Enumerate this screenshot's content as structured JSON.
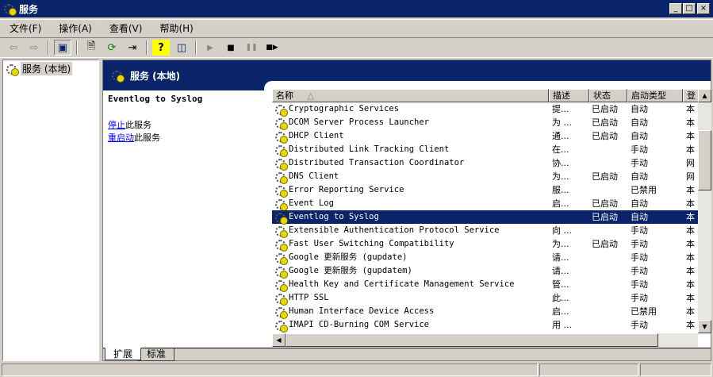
{
  "window": {
    "title": "服务",
    "min": "_",
    "max": "□",
    "close": "×"
  },
  "menu": [
    "文件(F)",
    "操作(A)",
    "查看(V)",
    "帮助(H)"
  ],
  "toolbar": {
    "icons": [
      "back-arrow-icon",
      "forward-arrow-icon",
      "show-hide-tree-icon",
      "properties-icon",
      "refresh-icon",
      "export-list-icon",
      "help-icon",
      "show-hide-action-pane-icon",
      "start-service-icon",
      "stop-service-icon",
      "pause-service-icon",
      "restart-service-icon"
    ],
    "glyphs": [
      "⇦",
      "⇨",
      "▣",
      "🗎",
      "⟳",
      "⇥",
      "?",
      "◫",
      "▶",
      "■",
      "❚❚",
      "■▶"
    ]
  },
  "tree": {
    "item": "服务 (本地)"
  },
  "header": {
    "title": "服务 (本地)"
  },
  "desc": {
    "service_name": "Eventlog to Syslog",
    "stop_link": "停止",
    "stop_suffix": "此服务",
    "restart_link": "重启动",
    "restart_suffix": "此服务"
  },
  "columns": {
    "name": "名称",
    "name_sort": "△",
    "desc": "描述",
    "status": "状态",
    "start": "启动类型",
    "logon": "登"
  },
  "rows": [
    {
      "name": "Cryptographic Services",
      "desc": "提...",
      "status": "已启动",
      "start": "自动",
      "logon": "本"
    },
    {
      "name": "DCOM Server Process Launcher",
      "desc": "为 ...",
      "status": "已启动",
      "start": "自动",
      "logon": "本"
    },
    {
      "name": "DHCP Client",
      "desc": "通...",
      "status": "已启动",
      "start": "自动",
      "logon": "本"
    },
    {
      "name": "Distributed Link Tracking Client",
      "desc": "在...",
      "status": "",
      "start": "手动",
      "logon": "本"
    },
    {
      "name": "Distributed Transaction Coordinator",
      "desc": "协...",
      "status": "",
      "start": "手动",
      "logon": "网"
    },
    {
      "name": "DNS Client",
      "desc": "为...",
      "status": "已启动",
      "start": "自动",
      "logon": "网"
    },
    {
      "name": "Error Reporting Service",
      "desc": "服...",
      "status": "",
      "start": "已禁用",
      "logon": "本"
    },
    {
      "name": "Event Log",
      "desc": "启...",
      "status": "已启动",
      "start": "自动",
      "logon": "本"
    },
    {
      "name": "Eventlog to Syslog",
      "desc": "",
      "status": "已启动",
      "start": "自动",
      "logon": "本"
    },
    {
      "name": "Extensible Authentication Protocol Service",
      "desc": "向 ...",
      "status": "",
      "start": "手动",
      "logon": "本"
    },
    {
      "name": "Fast User Switching Compatibility",
      "desc": "为...",
      "status": "已启动",
      "start": "手动",
      "logon": "本"
    },
    {
      "name": "Google 更新服务 (gupdate)",
      "desc": "请...",
      "status": "",
      "start": "手动",
      "logon": "本"
    },
    {
      "name": "Google 更新服务 (gupdatem)",
      "desc": "请...",
      "status": "",
      "start": "手动",
      "logon": "本"
    },
    {
      "name": "Health Key and Certificate Management Service",
      "desc": "管...",
      "status": "",
      "start": "手动",
      "logon": "本"
    },
    {
      "name": "HTTP SSL",
      "desc": "此...",
      "status": "",
      "start": "手动",
      "logon": "本"
    },
    {
      "name": "Human Interface Device Access",
      "desc": "启...",
      "status": "",
      "start": "已禁用",
      "logon": "本"
    },
    {
      "name": "IMAPI CD-Burning COM Service",
      "desc": "用 ...",
      "status": "",
      "start": "手动",
      "logon": "本"
    }
  ],
  "selected_row": 8,
  "tabs": [
    "扩展",
    "标准"
  ],
  "active_tab": 0,
  "colors": {
    "title_bg": "#0a246a",
    "selection": "#0a246a",
    "link": "#0000ff"
  }
}
